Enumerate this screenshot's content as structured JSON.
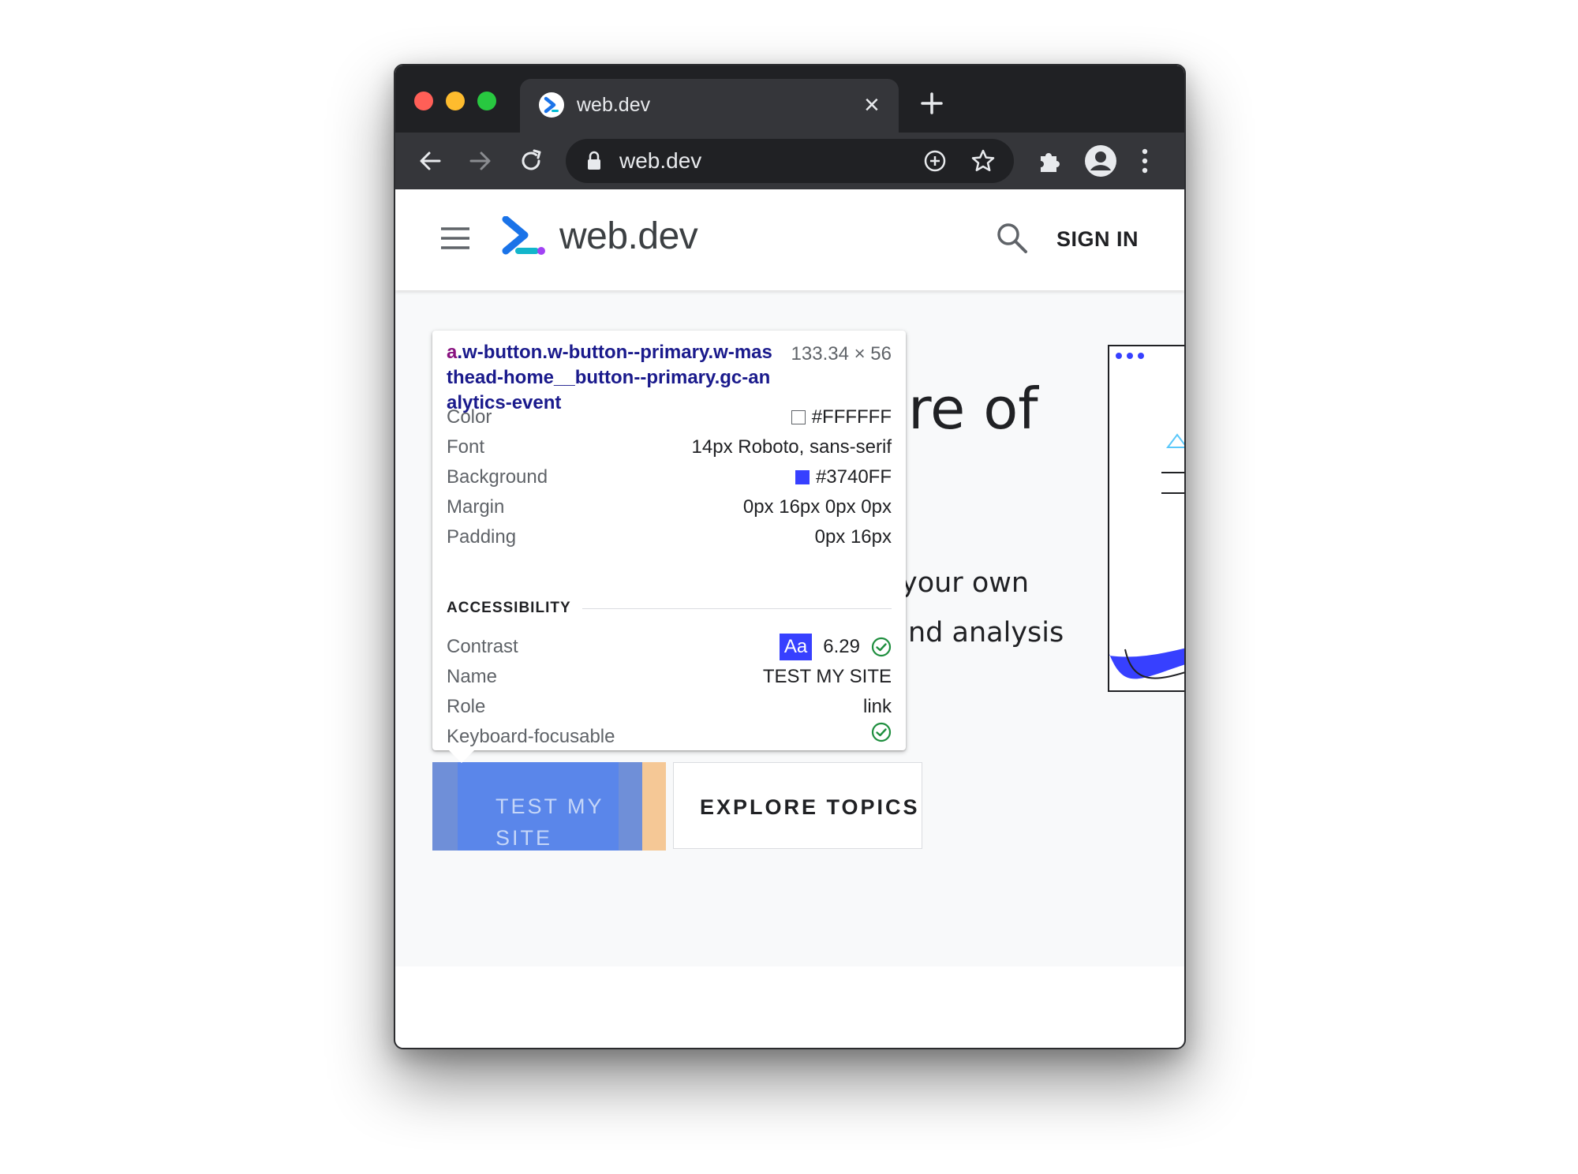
{
  "browser": {
    "tab_title": "web.dev",
    "tab_close": "×",
    "url": "web.dev"
  },
  "site": {
    "logo_text": "web.dev",
    "sign_in": "SIGN IN"
  },
  "hero": {
    "headline_fragment": "re of",
    "body_line1": "your own",
    "body_line2": "nd analysis"
  },
  "buttons": {
    "primary": "TEST MY SITE",
    "secondary": "EXPLORE TOPICS"
  },
  "inspector": {
    "selector_tag": "a",
    "selector_classes": ".w-button.w-button--primary.w-masthead-home__button--primary.gc-analytics-event",
    "size": "133.34 × 56",
    "rows": [
      {
        "label": "Color",
        "value": "#FFFFFF",
        "swatch": "#ffffff"
      },
      {
        "label": "Font",
        "value": "14px Roboto, sans-serif"
      },
      {
        "label": "Background",
        "value": "#3740FF",
        "swatch": "#3740ff"
      },
      {
        "label": "Margin",
        "value": "0px 16px 0px 0px"
      },
      {
        "label": "Padding",
        "value": "0px 16px"
      }
    ],
    "accessibility_heading": "ACCESSIBILITY",
    "contrast": {
      "label": "Contrast",
      "sample": "Aa",
      "ratio": "6.29"
    },
    "name": {
      "label": "Name",
      "value": "TEST MY SITE"
    },
    "role": {
      "label": "Role",
      "value": "link"
    },
    "keyboard": {
      "label": "Keyboard-focusable"
    }
  },
  "colors": {
    "brand_blue": "#3740ff",
    "check_green": "#1e8e3e",
    "titlebar": "#202124"
  }
}
